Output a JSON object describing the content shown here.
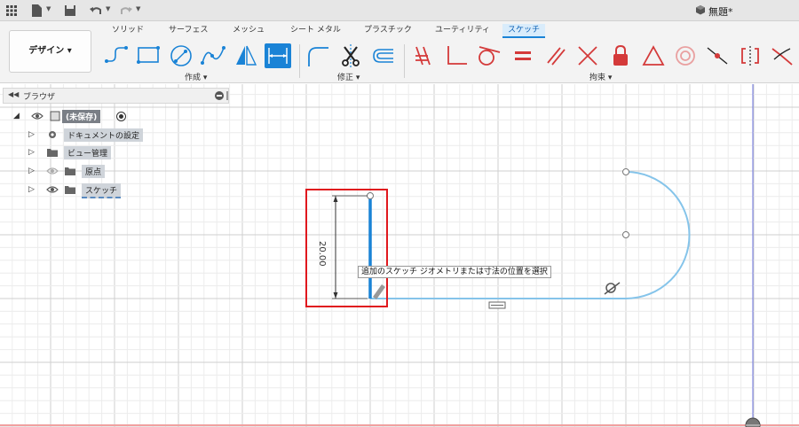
{
  "titlebar": {
    "grid_icon": "grid-icon",
    "file_icon": "file-icon",
    "save_icon": "save-icon",
    "undo_icon": "undo-icon",
    "redo_icon": "redo-icon",
    "doc_title": "無題*"
  },
  "ribbon": {
    "tabs": [
      "ソリッド",
      "サーフェス",
      "メッシュ",
      "シート メタル",
      "プラスチック",
      "ユーティリティ",
      "スケッチ"
    ],
    "active_tab": "スケッチ",
    "workspace_label": "デザイン ▾",
    "groups": {
      "create": "作成 ▾",
      "modify": "修正 ▾",
      "constrain": "拘束 ▾"
    },
    "tools": [
      "line-tool",
      "rectangle-tool",
      "circle-tool",
      "spline-tool",
      "mirror-tool",
      "sketch-dimension-tool",
      "fillet-tool",
      "trim-tool",
      "offset-tool",
      "coincident-constraint",
      "perpendicular-constraint",
      "tangent-constraint",
      "equal-constraint",
      "parallel-constraint",
      "perpendicular-x-constraint",
      "fix-constraint",
      "midpoint-constraint",
      "concentric-constraint",
      "collinear-constraint",
      "symmetry-constraint",
      "curvature-constraint"
    ],
    "accent_color": "#1a83d6",
    "constraint_color": "#d43a3a"
  },
  "browser": {
    "title": "ブラウザ",
    "root_label": "(未保存)",
    "items": [
      {
        "label": "ドキュメントの設定"
      },
      {
        "label": "ビュー管理"
      },
      {
        "label": "原点"
      },
      {
        "label": "スケッチ"
      }
    ]
  },
  "canvas": {
    "dimension_value": "20.00",
    "tooltip": "追加のスケッチ ジオメトリまたは寸法の位置を選択",
    "sketch_line_color": "#85c4ea",
    "selected_line_color": "#1a83d6",
    "highlight_box_color": "#e0181e"
  }
}
